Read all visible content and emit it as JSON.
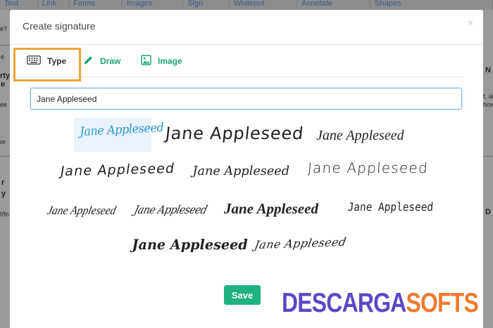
{
  "background": {
    "toolbar": [
      "Text",
      "Link",
      "Forms",
      "Images",
      "Sign",
      "Whiteout",
      "Annotate",
      "Shapes"
    ],
    "left_fragments": [
      "e?",
      "e",
      "rty",
      "e",
      "ee",
      "or",
      "r",
      "y",
      "f/fo"
    ],
    "right_fragments": [
      "N",
      "t, an",
      "how",
      "D"
    ]
  },
  "dialog": {
    "title": "Create signature",
    "close_icon": "×"
  },
  "tabs": [
    {
      "label": "Type",
      "icon": "keyboard-icon",
      "active": true
    },
    {
      "label": "Draw",
      "icon": "pencil-icon",
      "active": false
    },
    {
      "label": "Image",
      "icon": "image-icon",
      "active": false
    }
  ],
  "name_input": {
    "value": "Jane Appleseed"
  },
  "signatures": [
    "Jane Appleseed",
    "Jane Appleseed",
    "Jane Appleseed",
    "Jane Appleseed",
    "Jane Appleseed",
    "Jane Appleseed",
    "Jane Appleseed",
    "Jane Appleseed",
    "Jane Appleseed",
    "Jane Appleseed",
    "Jane Appleseed",
    "Jane Appleseed"
  ],
  "save_label": "Save",
  "watermark": {
    "part1": "DESCARGA",
    "part2": "SOFTS"
  },
  "colors": {
    "accent_green": "#1fb27e",
    "tab_green": "#1aa57a",
    "highlight_orange": "#f0a33a",
    "selected_signature": "#2b9bd1",
    "watermark_purple": "#5a48c6",
    "watermark_orange": "#f07a2e"
  }
}
